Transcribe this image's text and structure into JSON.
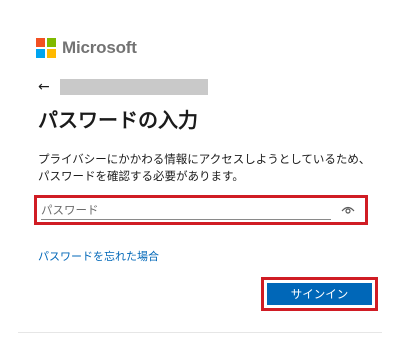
{
  "brand": {
    "name": "Microsoft",
    "logo_colors": [
      "#f25022",
      "#7fba00",
      "#00a4ef",
      "#ffb900"
    ]
  },
  "identity": {
    "back_icon": "back-arrow-icon"
  },
  "page": {
    "title": "パスワードの入力",
    "description": "プライバシーにかかわる情報にアクセスしようとしているため、パスワードを確認する必要があります。"
  },
  "password_field": {
    "placeholder": "パスワード",
    "value": "",
    "reveal_icon": "eye-icon"
  },
  "links": {
    "forgot_password": "パスワードを忘れた場合"
  },
  "actions": {
    "sign_in_label": "サインイン"
  },
  "colors": {
    "accent": "#0067b8",
    "highlight": "#d01c24"
  }
}
